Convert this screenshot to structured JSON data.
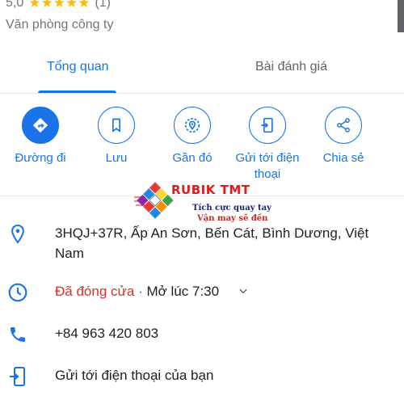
{
  "header": {
    "rating": "5,0",
    "stars": "★★★★★",
    "review_count": "(1)",
    "category": "Văn phòng công ty"
  },
  "tabs": [
    {
      "label": "Tổng quan",
      "active": true
    },
    {
      "label": "Bài đánh giá",
      "active": false
    }
  ],
  "actions": [
    {
      "label": "Đường đi",
      "icon": "directions-icon"
    },
    {
      "label": "Lưu",
      "icon": "bookmark-icon"
    },
    {
      "label": "Gần đó",
      "icon": "nearby-icon"
    },
    {
      "label": "Gửi tới điện thoại",
      "icon": "send-to-phone-icon"
    },
    {
      "label": "Chia sẻ",
      "icon": "share-icon"
    }
  ],
  "info": {
    "address": "3HQJ+37R, Ấp An Sơn, Bến Cát, Bình Dương, Việt Nam",
    "hours_status": "Đã đóng cửa",
    "hours_separator": "·",
    "hours_open": "Mở lúc 7:30",
    "phone": "+84 963 420 803",
    "send_to_phone": "Gửi tới điện thoại của bạn"
  },
  "watermark": {
    "title": "RUBIK TMT",
    "line1": "Tích cực quay tay",
    "line2": "Vận may sẽ đến"
  },
  "colors": {
    "accent": "#1a73e8",
    "star": "#fbbc04",
    "closed": "#d93025",
    "secondary_text": "#70757a"
  }
}
